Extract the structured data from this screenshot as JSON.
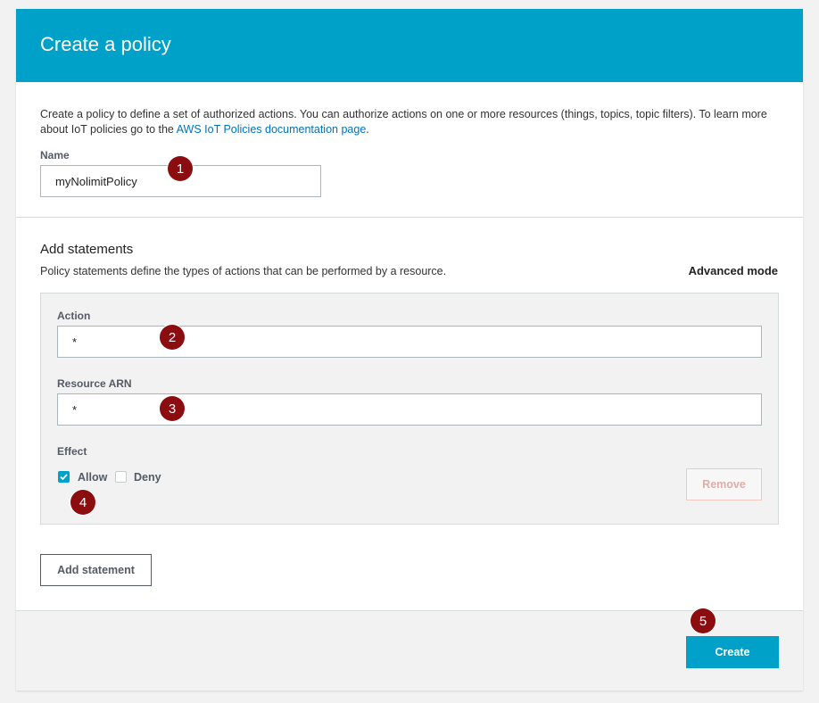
{
  "header": {
    "title": "Create a policy"
  },
  "intro": {
    "text": "Create a policy to define a set of authorized actions. You can authorize actions on one or more resources (things, topics, topic filters). To learn more about IoT policies go to the ",
    "link": "AWS IoT Policies documentation page",
    "suffix": "."
  },
  "name_field": {
    "label": "Name",
    "value": "myNolimitPolicy"
  },
  "statements": {
    "title": "Add statements",
    "description": "Policy statements define the types of actions that can be performed by a resource.",
    "advanced_mode": "Advanced mode",
    "action": {
      "label": "Action",
      "value": "*"
    },
    "resource": {
      "label": "Resource ARN",
      "value": "*"
    },
    "effect": {
      "label": "Effect",
      "allow_label": "Allow",
      "allow_checked": true,
      "deny_label": "Deny",
      "deny_checked": false
    },
    "remove_button": "Remove",
    "add_button": "Add statement"
  },
  "footer": {
    "create_button": "Create"
  },
  "markers": [
    "1",
    "2",
    "3",
    "4",
    "5"
  ],
  "colors": {
    "accent": "#00a1c9",
    "marker": "#8b0d10"
  }
}
